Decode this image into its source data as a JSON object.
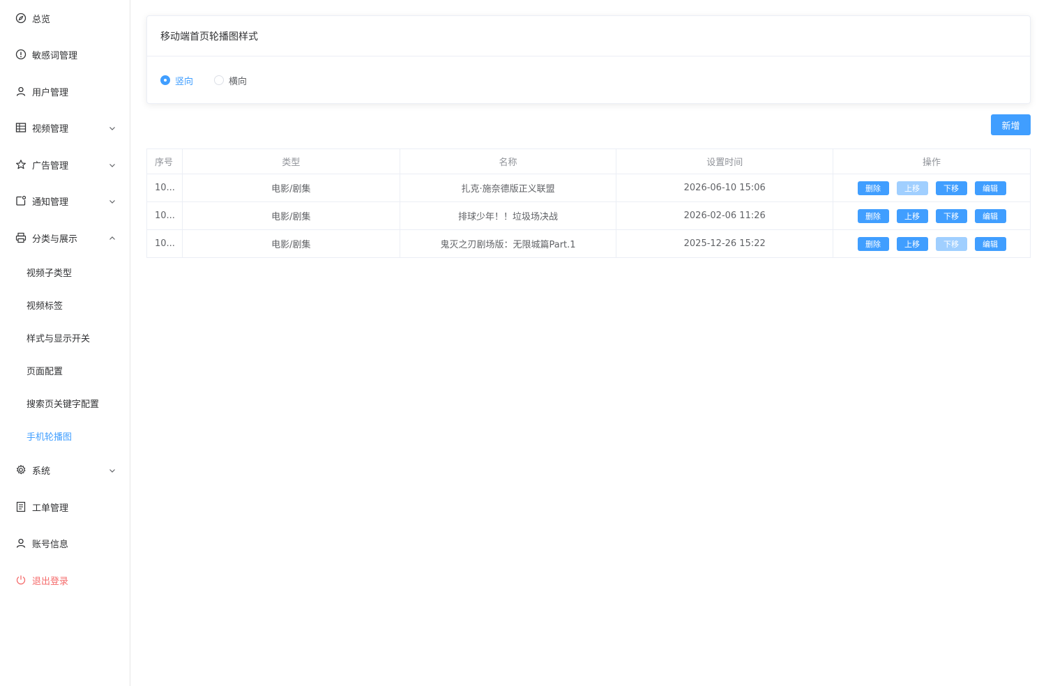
{
  "sidebar": {
    "items": [
      {
        "label": "总览",
        "icon": "compass-icon"
      },
      {
        "label": "敏感词管理",
        "icon": "warning-icon"
      },
      {
        "label": "用户管理",
        "icon": "user-icon"
      },
      {
        "label": "视频管理",
        "icon": "grid-icon"
      },
      {
        "label": "广告管理",
        "icon": "star-icon"
      },
      {
        "label": "通知管理",
        "icon": "notification-icon"
      },
      {
        "label": "分类与展示",
        "icon": "printer-icon"
      },
      {
        "label": "系统",
        "icon": "gear-icon"
      },
      {
        "label": "工单管理",
        "icon": "document-icon"
      },
      {
        "label": "账号信息",
        "icon": "user-icon"
      },
      {
        "label": "退出登录",
        "icon": "power-icon"
      }
    ],
    "sub_items": [
      {
        "label": "视频子类型"
      },
      {
        "label": "视频标签"
      },
      {
        "label": "样式与显示开关"
      },
      {
        "label": "页面配置"
      },
      {
        "label": "搜索页关键字配置"
      },
      {
        "label": "手机轮播图",
        "active": true
      }
    ]
  },
  "style_card": {
    "title": "移动端首页轮播图样式",
    "options": [
      {
        "label": "竖向",
        "selected": true
      },
      {
        "label": "横向",
        "selected": false
      }
    ]
  },
  "toolbar": {
    "add_label": "新增"
  },
  "table": {
    "headers": [
      "序号",
      "类型",
      "名称",
      "设置时间",
      "操作"
    ],
    "rows": [
      {
        "seq": "10...",
        "type": "电影/剧集",
        "name": "扎克·施奈德版正义联盟",
        "time": "2026-06-10 15:06",
        "up_disabled": true,
        "down_disabled": false
      },
      {
        "seq": "10...",
        "type": "电影/剧集",
        "name": "排球少年！！垃圾场决战",
        "time": "2026-02-06 11:26",
        "up_disabled": false,
        "down_disabled": false
      },
      {
        "seq": "10...",
        "type": "电影/剧集",
        "name": "鬼灭之刃剧场版：无限城篇Part.1",
        "time": "2025-12-26 15:22",
        "up_disabled": false,
        "down_disabled": true
      }
    ],
    "actions": {
      "delete": "删除",
      "up": "上移",
      "down": "下移",
      "edit": "编辑"
    }
  },
  "colors": {
    "primary": "#409eff",
    "primary_disabled": "#a0cfff",
    "danger": "#f56c6c"
  }
}
